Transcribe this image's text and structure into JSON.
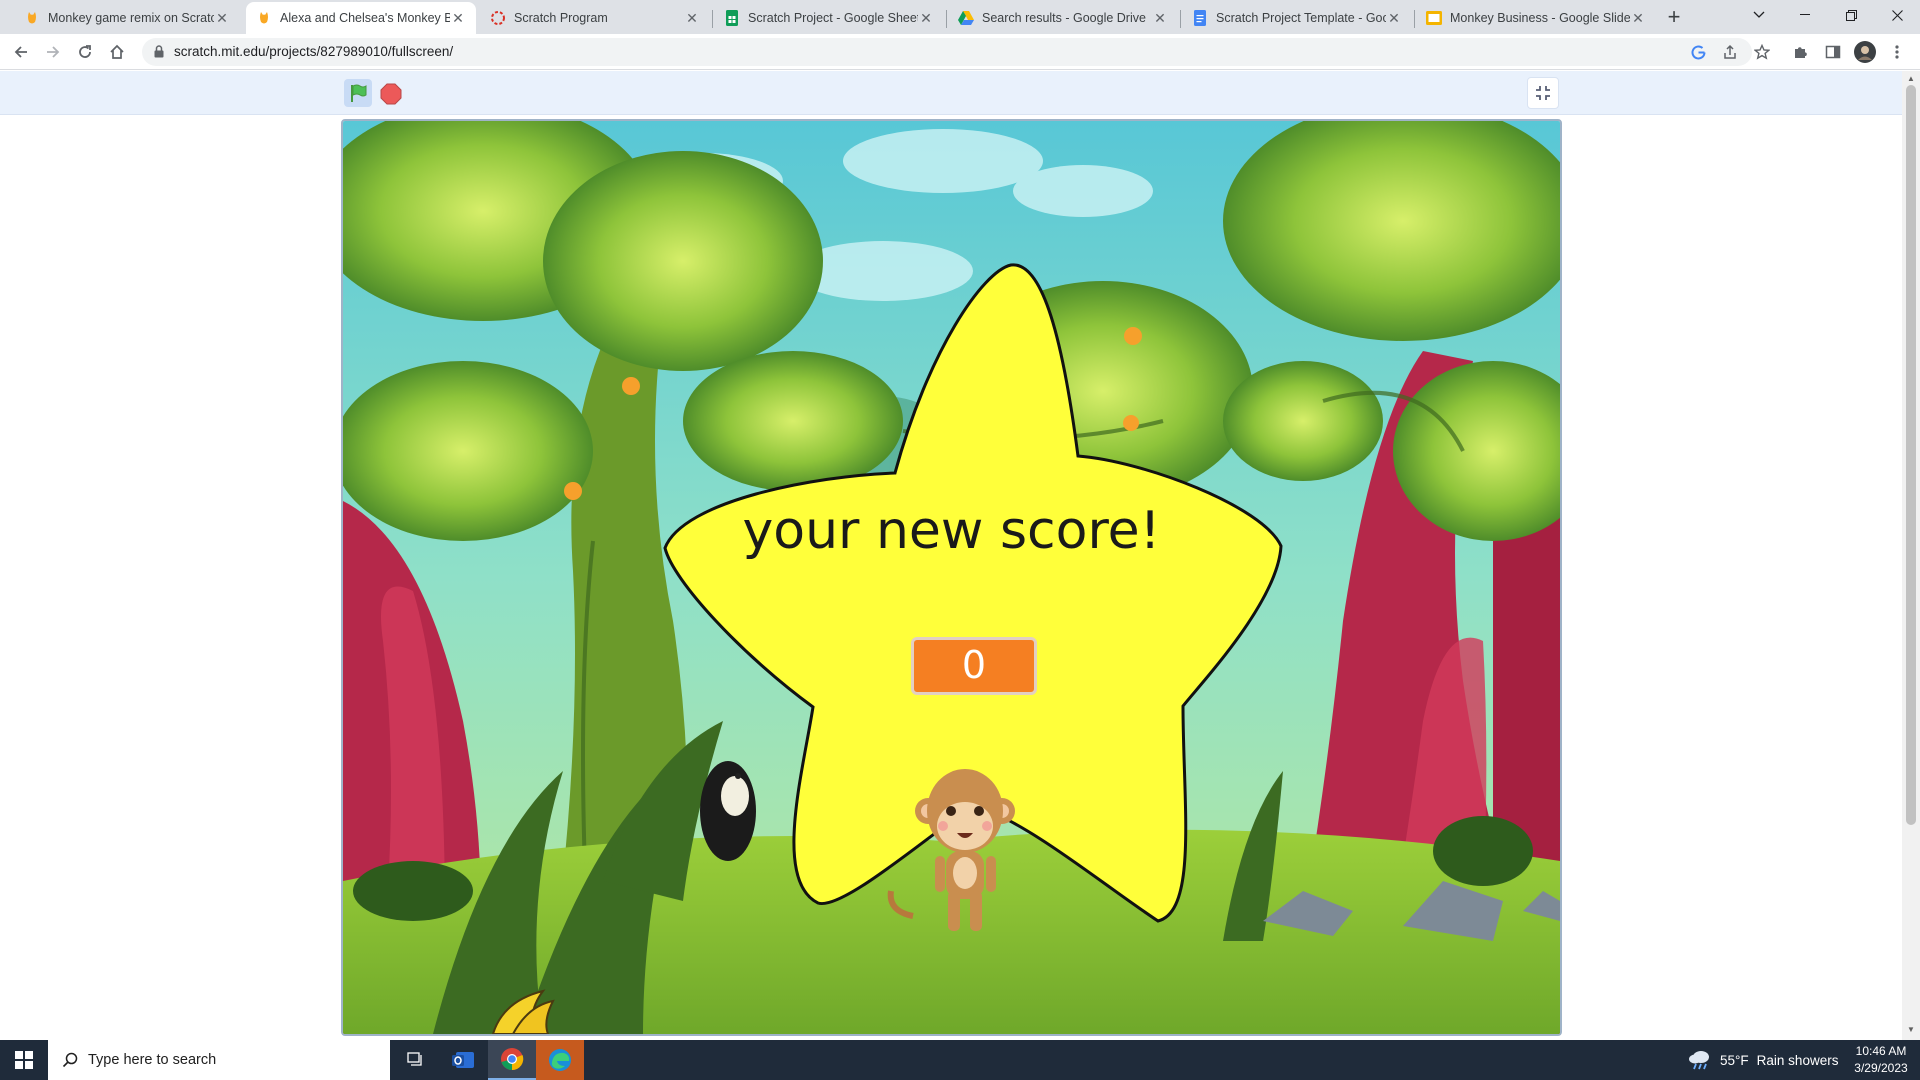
{
  "browser": {
    "tabs": [
      {
        "title": "Monkey game remix on Scratch",
        "active": false,
        "favicon": "scratch-cat-icon"
      },
      {
        "title": "Alexa and Chelsea's Monkey Bu",
        "active": true,
        "favicon": "scratch-cat-icon"
      },
      {
        "title": "Scratch Program",
        "active": false,
        "favicon": "loading-spinner-icon"
      },
      {
        "title": "Scratch Project - Google Sheets",
        "active": false,
        "favicon": "google-sheets-icon"
      },
      {
        "title": "Search results - Google Drive",
        "active": false,
        "favicon": "google-drive-icon"
      },
      {
        "title": "Scratch Project Template - Goog",
        "active": false,
        "favicon": "google-docs-icon"
      },
      {
        "title": "Monkey Business - Google Slide",
        "active": false,
        "favicon": "google-slides-icon"
      }
    ],
    "close_glyph": "✕",
    "new_tab_glyph": "+",
    "url": "scratch.mit.edu/projects/827989010/fullscreen/"
  },
  "scratch": {
    "message": "your new score!",
    "score": "0"
  },
  "taskbar": {
    "search_placeholder": "Type here to search",
    "weather_temp": "55°F",
    "weather_desc": "Rain showers",
    "time": "10:46 AM",
    "date": "3/29/2023"
  },
  "colors": {
    "star_fill": "#ffff3a",
    "score_box": "#f57f22",
    "flag_green": "#4cbf56",
    "stop_red": "#ec5959"
  }
}
